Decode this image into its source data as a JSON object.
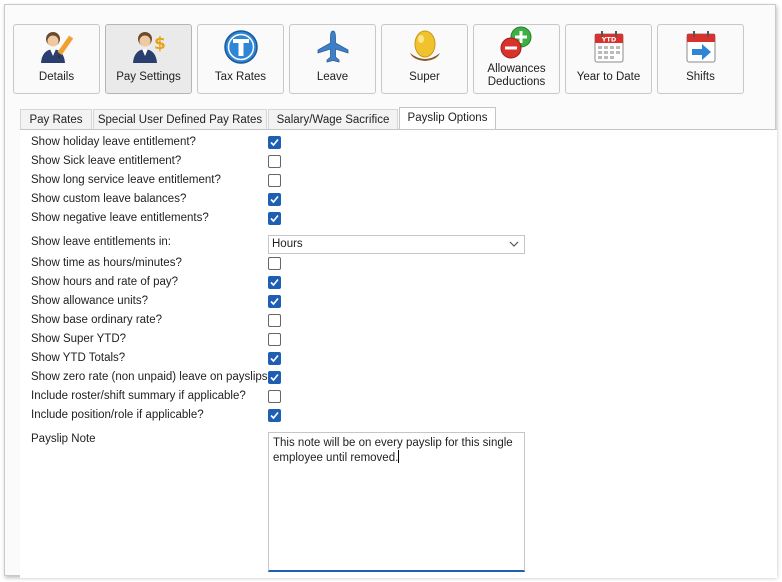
{
  "toolbar": [
    {
      "label": "Details",
      "icon": "person-pencil-icon",
      "active": false
    },
    {
      "label": "Pay Settings",
      "icon": "person-dollar-icon",
      "active": true
    },
    {
      "label": "Tax Rates",
      "icon": "tax-t-icon",
      "active": false
    },
    {
      "label": "Leave",
      "icon": "airplane-icon",
      "active": false
    },
    {
      "label": "Super",
      "icon": "nest-egg-icon",
      "active": false
    },
    {
      "label": "Allowances Deductions",
      "line1": "Allowances",
      "line2": "Deductions",
      "icon": "plus-minus-icon",
      "active": false
    },
    {
      "label": "Year to Date",
      "icon": "ytd-calendar-icon",
      "active": false
    },
    {
      "label": "Shifts",
      "icon": "calendar-arrow-icon",
      "active": false
    }
  ],
  "tabs": [
    {
      "label": "Pay Rates",
      "active": false
    },
    {
      "label": "Special User Defined Pay Rates",
      "active": false
    },
    {
      "label": "Salary/Wage Sacrifice",
      "active": false
    },
    {
      "label": "Payslip Options",
      "active": true
    }
  ],
  "options": [
    {
      "label": "Show holiday leave entitlement?",
      "checked": true
    },
    {
      "label": "Show Sick leave entitlement?",
      "checked": false
    },
    {
      "label": "Show long service leave entitlement?",
      "checked": false
    },
    {
      "label": "Show custom leave balances?",
      "checked": true
    },
    {
      "label": "Show negative leave entitlements?",
      "checked": true
    }
  ],
  "leave_units": {
    "label": "Show leave entitlements in:",
    "value": "Hours"
  },
  "options2": [
    {
      "label": "Show time as hours/minutes?",
      "checked": false
    },
    {
      "label": "Show hours and rate of pay?",
      "checked": true
    },
    {
      "label": "Show allowance units?",
      "checked": true
    },
    {
      "label": "Show base ordinary rate?",
      "checked": false
    },
    {
      "label": "Show Super YTD?",
      "checked": false
    },
    {
      "label": "Show YTD Totals?",
      "checked": true
    },
    {
      "label": "Show zero rate (non unpaid) leave on payslips?",
      "checked": true
    },
    {
      "label": "Include roster/shift summary if applicable?",
      "checked": false
    },
    {
      "label": "Include position/role if applicable?",
      "checked": true
    }
  ],
  "payslip_note": {
    "label": "Payslip Note",
    "value": "This note will be on every payslip for this single employee until removed."
  },
  "colors": {
    "accent": "#1e5fb4"
  }
}
